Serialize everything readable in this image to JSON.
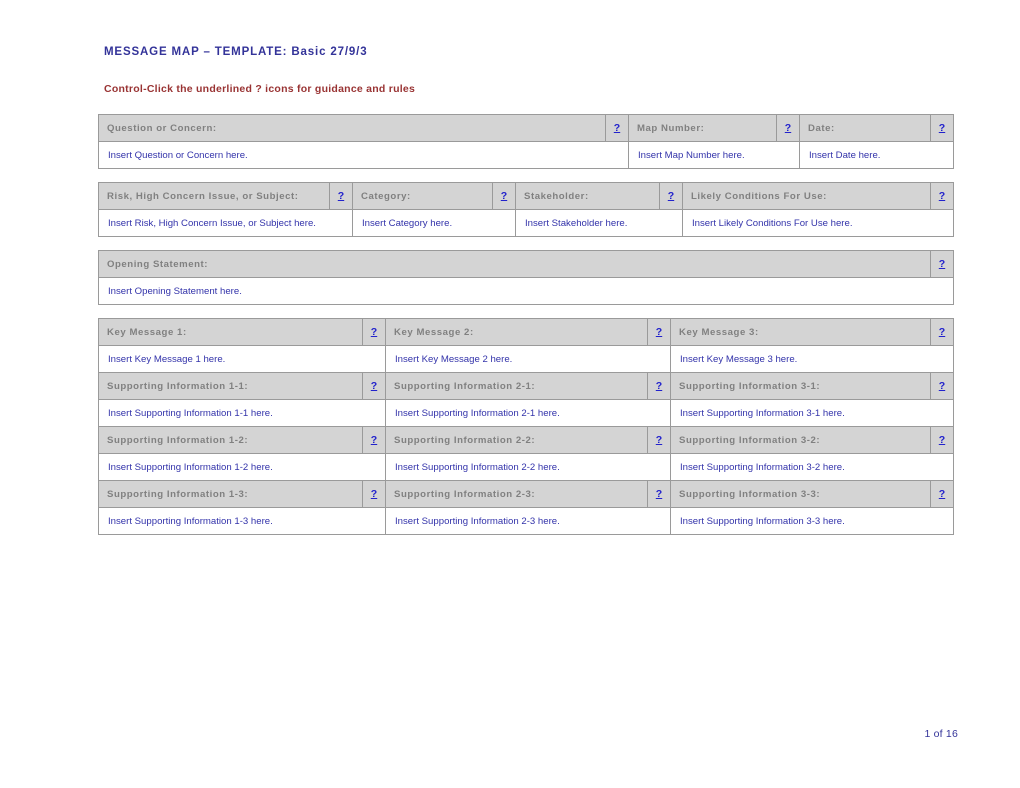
{
  "document": {
    "title": "MESSAGE MAP – TEMPLATE: Basic 27/9/3",
    "subtitle": "Control-Click the underlined ? icons for guidance and rules",
    "footer": "1 of 16",
    "help_glyph": "?",
    "colors": {
      "title": "#333399",
      "subtitle": "#993333",
      "header_bg": "#d4d4d4",
      "header_text": "#808080",
      "value_text": "#3333aa",
      "help_link": "#2222cc",
      "border": "#9a9a9a"
    }
  },
  "tables": [
    {
      "id": "question-table",
      "rows": [
        {
          "headers": [
            "Question or Concern:",
            "Map Number:",
            "Date:"
          ],
          "values": [
            "Insert Question or Concern here.",
            "Insert Map Number here.",
            "Insert Date here."
          ]
        }
      ]
    },
    {
      "id": "risk-table",
      "rows": [
        {
          "headers": [
            "Risk, High Concern Issue, or Subject:",
            "Category:",
            "Stakeholder:",
            "Likely Conditions For Use:"
          ],
          "values": [
            "Insert Risk, High Concern Issue, or Subject here.",
            "Insert Category here.",
            "Insert Stakeholder here.",
            "Insert Likely Conditions For Use here."
          ]
        }
      ]
    },
    {
      "id": "opening-statement-table",
      "rows": [
        {
          "headers": [
            "Opening Statement:"
          ],
          "values": [
            "Insert Opening Statement here."
          ]
        }
      ]
    },
    {
      "id": "key-message-table",
      "rows": [
        {
          "headers": [
            "Key Message 1:",
            "Key Message 2:",
            "Key Message 3:"
          ],
          "values": [
            "Insert Key Message 1 here.",
            "Insert Key Message 2 here.",
            "Insert Key Message 3 here."
          ]
        },
        {
          "headers": [
            "Supporting Information 1-1:",
            "Supporting Information 2-1:",
            "Supporting Information 3-1:"
          ],
          "values": [
            "Insert Supporting Information 1-1 here.",
            "Insert Supporting Information 2-1 here.",
            "Insert Supporting Information 3-1 here."
          ]
        },
        {
          "headers": [
            "Supporting Information 1-2:",
            "Supporting Information 2-2:",
            "Supporting Information 3-2:"
          ],
          "values": [
            "Insert Supporting Information 1-2 here.",
            "Insert Supporting Information 2-2 here.",
            "Insert Supporting Information 3-2 here."
          ]
        },
        {
          "headers": [
            "Supporting Information 1-3:",
            "Supporting Information 2-3:",
            "Supporting Information 3-3:"
          ],
          "values": [
            "Insert Supporting Information 1-3 here.",
            "Insert Supporting Information 2-3 here.",
            "Insert Supporting Information 3-3 here."
          ]
        }
      ]
    }
  ]
}
